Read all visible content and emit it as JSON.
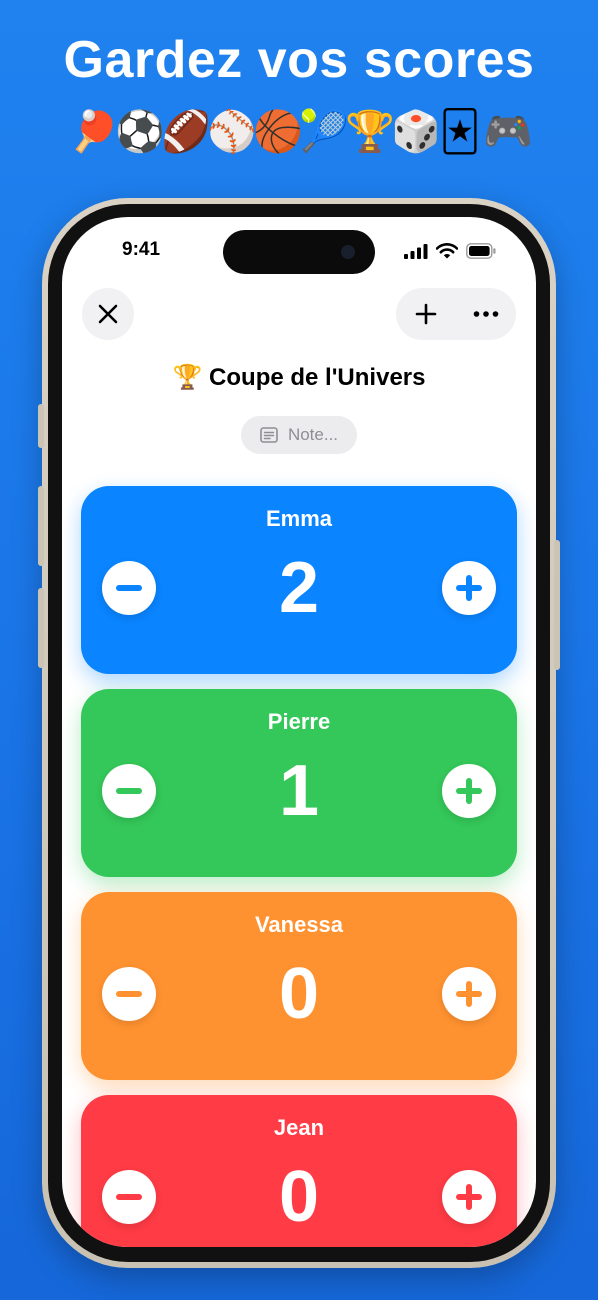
{
  "promo": {
    "headline": "Gardez vos scores",
    "emojis": [
      "🏓",
      "⚽",
      "🏈",
      "⚾",
      "🏀",
      "🎾",
      "🏆",
      "🎲",
      "🃏",
      "🎮"
    ]
  },
  "status_bar": {
    "time": "9:41"
  },
  "toolbar": {
    "close_icon": "xmark-icon",
    "add_icon": "plus-icon",
    "more_icon": "ellipsis-icon"
  },
  "game": {
    "title": "🏆 Coupe de l'Univers",
    "note_placeholder": "Note..."
  },
  "players": [
    {
      "name": "Emma",
      "score": "2",
      "color": "#0a84ff"
    },
    {
      "name": "Pierre",
      "score": "1",
      "color": "#34c759"
    },
    {
      "name": "Vanessa",
      "score": "0",
      "color": "#ff9230"
    },
    {
      "name": "Jean",
      "score": "0",
      "color": "#ff3b45"
    }
  ]
}
